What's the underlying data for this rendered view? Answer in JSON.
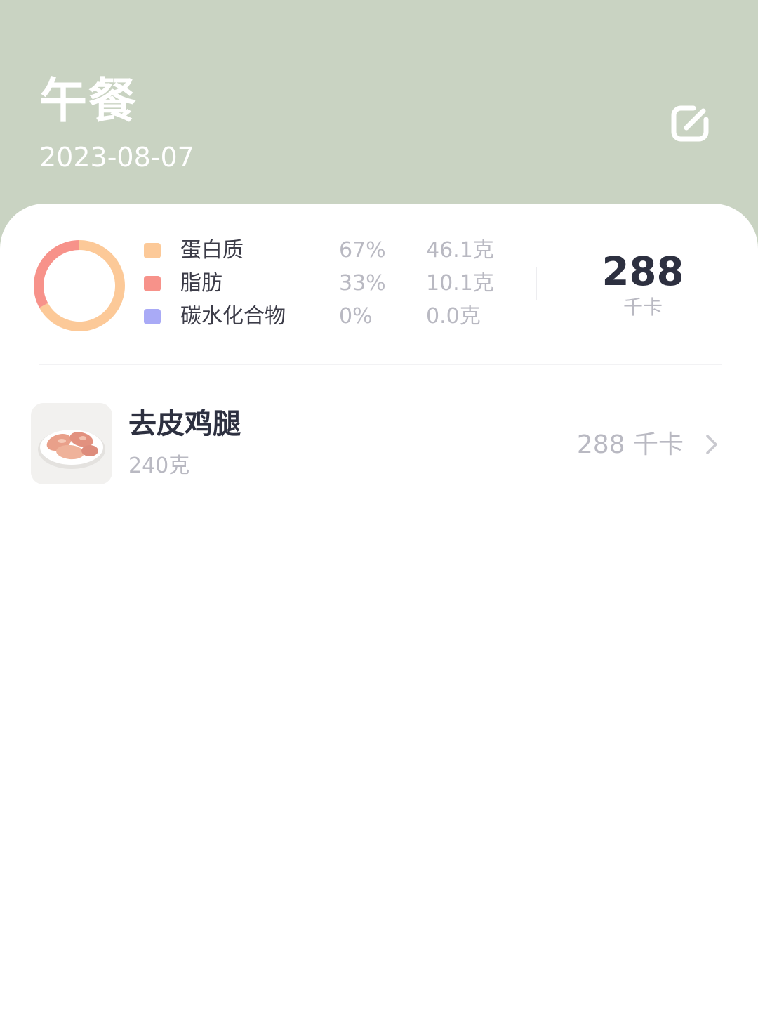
{
  "header": {
    "title": "午餐",
    "date": "2023-08-07",
    "edit_icon": "edit-icon",
    "background_color": "#c9d3c2"
  },
  "nutrition": {
    "chart_data": {
      "type": "pie",
      "categories": [
        "蛋白质",
        "脂肪",
        "碳水化合物"
      ],
      "values": [
        67,
        33,
        0
      ],
      "colors": [
        "#fcc998",
        "#f7928a",
        "#a9aaf6"
      ]
    },
    "legend": [
      {
        "name": "蛋白质",
        "percent": "67%",
        "grams": "46.1克",
        "color": "#fcc998"
      },
      {
        "name": "脂肪",
        "percent": "33%",
        "grams": "10.1克",
        "color": "#f7928a"
      },
      {
        "name": "碳水化合物",
        "percent": "0%",
        "grams": "0.0克",
        "color": "#a9aaf6"
      }
    ],
    "total_kcal": "288",
    "kcal_unit": "千卡"
  },
  "food_items": [
    {
      "name": "去皮鸡腿",
      "weight": "240克",
      "kcal": "288 千卡",
      "image_icon": "food-photo-icon",
      "chevron_icon": "chevron-right-icon"
    }
  ]
}
